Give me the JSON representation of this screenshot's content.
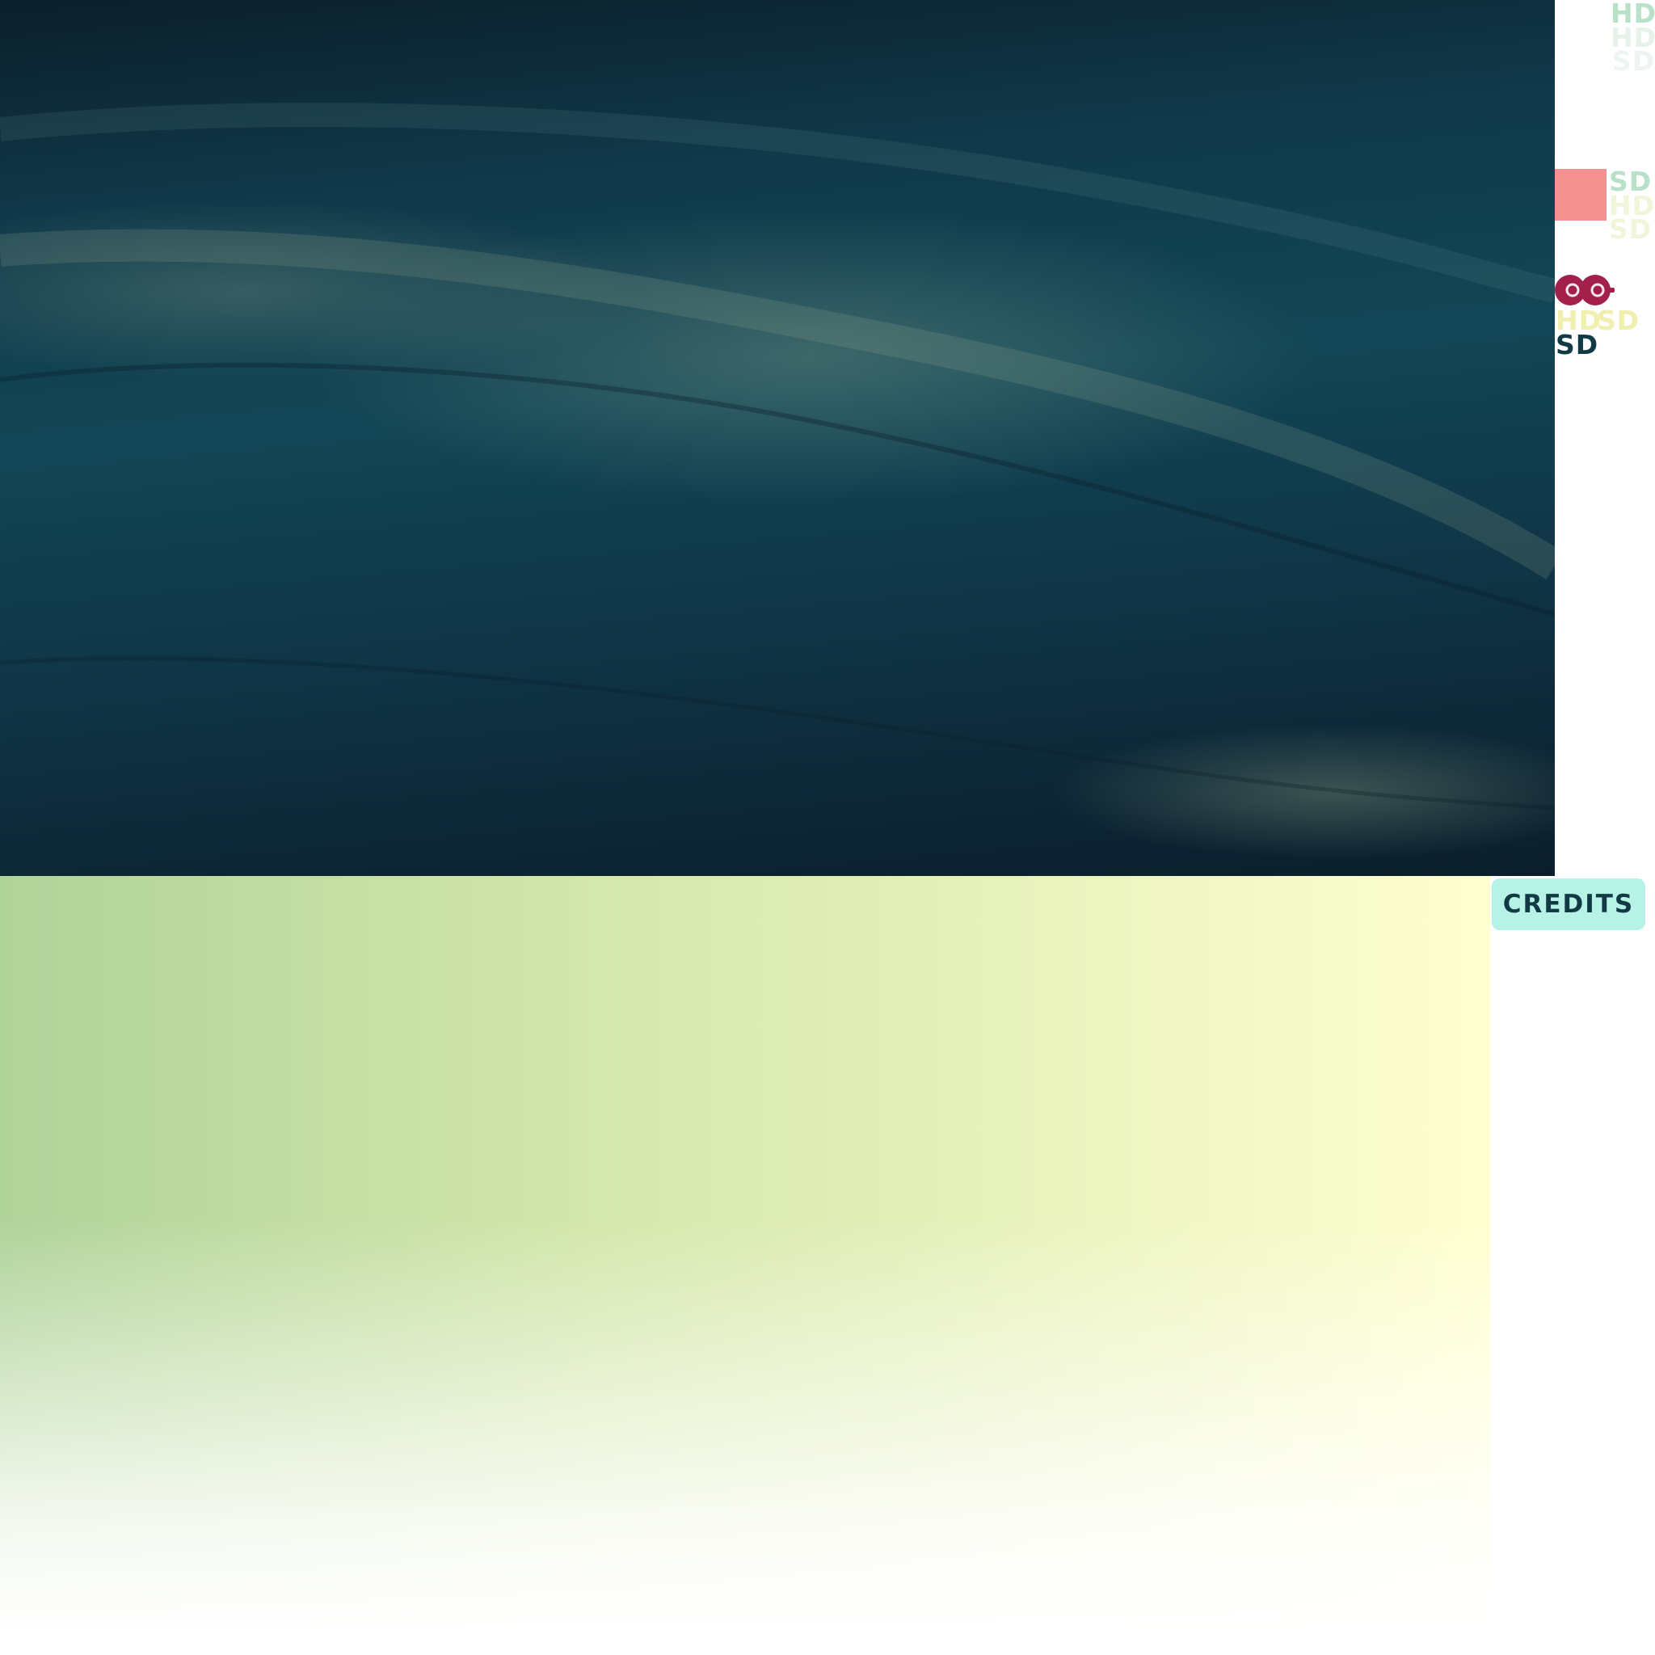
{
  "quality_labels": {
    "group_top": [
      "HD",
      "HD",
      "SD"
    ],
    "group_middle": [
      "SD",
      "HD",
      "SD"
    ],
    "group_bottom_inline": [
      "HD",
      "SD"
    ],
    "group_bottom_last": "SD"
  },
  "colors": {
    "mint": "#b9e1c8",
    "pale_mint": "#e7f3ea",
    "pale_yellow": "#f2f5d9",
    "yellow": "#f1efb0",
    "dark_teal": "#113a45",
    "swatch_pink": "#f49191",
    "eyes_crimson": "#a2204a",
    "credits_bg": "#b6f2e6"
  },
  "icons": {
    "swatch": "color-swatch",
    "eyes": "eyes-icon"
  },
  "credits": {
    "label": "CREDITS"
  }
}
